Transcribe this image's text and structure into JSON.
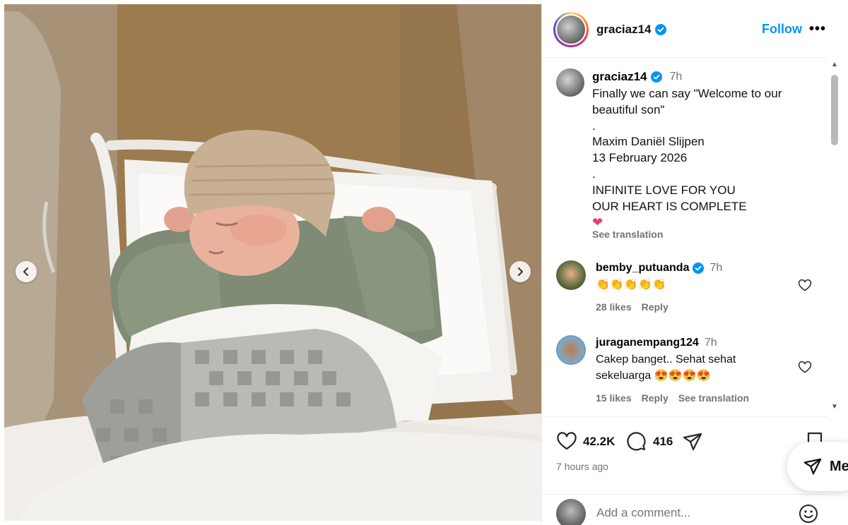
{
  "post": {
    "username": "graciaz14",
    "follow_label": "Follow",
    "more_label": "•••"
  },
  "caption": {
    "username": "graciaz14",
    "time": "7h",
    "lines": [
      "Finally we can say \"Welcome to our",
      "beautiful son\"",
      ".",
      "Maxim Daniël Slijpen",
      "13 February 2026",
      ".",
      "INFINITE LOVE FOR YOU",
      "OUR HEART IS COMPLETE"
    ],
    "emoji": "❤",
    "see_translation": "See translation"
  },
  "comments": [
    {
      "username": "bemby_putuanda",
      "verified": true,
      "time": "7h",
      "text": "👏👏👏👏👏",
      "likes": "28 likes",
      "reply": "Reply"
    },
    {
      "username": "juraganempang124",
      "verified": false,
      "time": "7h",
      "text": "Cakep banget.. Sehat sehat sekeluarga 😍😍😍😍",
      "likes": "15 likes",
      "reply": "Reply",
      "see_translation": "See translation"
    }
  ],
  "stats": {
    "likes": "42.2K",
    "comments": "416",
    "time_ago": "7 hours ago"
  },
  "add_comment": {
    "placeholder": "Add a comment..."
  },
  "messages_pill": {
    "label": "Me"
  },
  "colors": {
    "link_blue": "#0095f6",
    "verified_blue": "#0095f6",
    "muted_text": "#737373"
  }
}
